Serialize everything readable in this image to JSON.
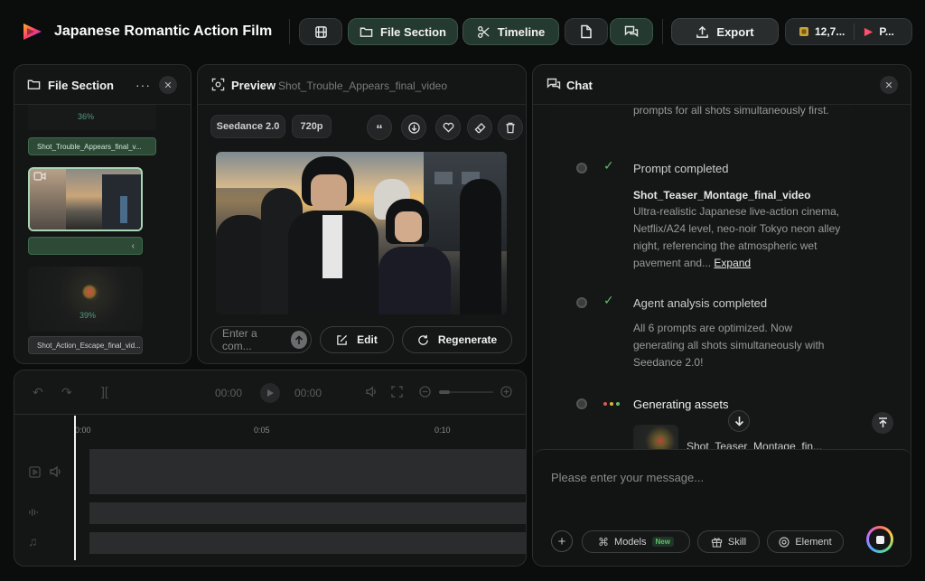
{
  "app": {
    "title": "Japanese Romantic Action Film"
  },
  "toolbar": {
    "file_section": "File Section",
    "timeline": "Timeline",
    "export": "Export",
    "credits": "12,7...",
    "profile": "P..."
  },
  "file_panel": {
    "title": "File Section",
    "items": [
      {
        "progress": "36%",
        "name": "Shot_Trouble_Appears_final_v..."
      },
      {
        "progress": "",
        "name": ""
      },
      {
        "progress": "39%",
        "name": "Shot_Action_Escape_final_vid..."
      }
    ]
  },
  "preview": {
    "title": "Preview",
    "file": "Shot_Trouble_Appears_final_video",
    "model": "Seedance 2.0",
    "resolution": "720p",
    "comment_placeholder": "Enter a com...",
    "edit": "Edit",
    "regenerate": "Regenerate"
  },
  "timeline": {
    "current": "00:00",
    "total": "00:00",
    "ticks": [
      "0:00",
      "0:05",
      "0:10"
    ]
  },
  "chat": {
    "title": "Chat",
    "intro": "prompts for all shots simultaneously first.",
    "steps": [
      {
        "title": "Prompt completed",
        "status": "done",
        "subtitle": "Shot_Teaser_Montage_final_video",
        "text": "Ultra-realistic Japanese live-action cinema, Netflix/A24 level, neo-noir Tokyo neon alley night, referencing the atmospheric wet pavement and...",
        "link": "Expand"
      },
      {
        "title": "Agent analysis completed",
        "status": "done",
        "text": "All 6 prompts are optimized. Now generating all shots simultaneously with Seedance 2.0!"
      },
      {
        "title": "Generating assets",
        "status": "running",
        "asset": "Shot_Teaser_Montage_fin..."
      }
    ],
    "input_placeholder": "Please enter your message...",
    "models": "Models",
    "models_badge": "New",
    "skill": "Skill",
    "element": "Element"
  },
  "colors": {
    "background": "#0b0c0c",
    "panel": "#141515",
    "accent_green": "#24392f",
    "check_green": "#5fbf6a"
  }
}
